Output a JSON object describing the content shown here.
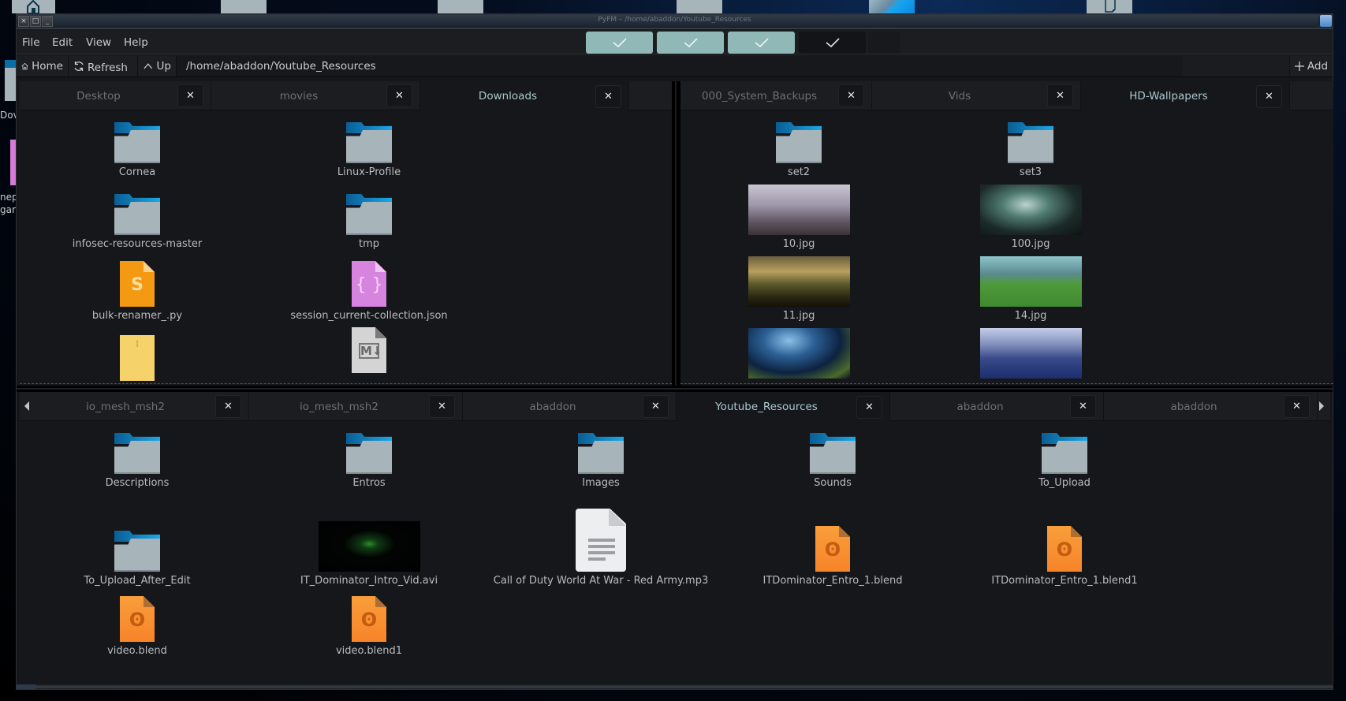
{
  "window": {
    "title": "PyFM – /home/abaddon/Youtube_Resources",
    "controls": [
      "close",
      "maximize",
      "minimize"
    ]
  },
  "desktop": {
    "left_labels": [
      "Dov",
      "nep",
      "gar"
    ]
  },
  "menubar": {
    "items": [
      "File",
      "Edit",
      "View",
      "Help"
    ],
    "check_buttons": [
      {
        "checked": true,
        "style": "active"
      },
      {
        "checked": true,
        "style": "active"
      },
      {
        "checked": true,
        "style": "active"
      },
      {
        "checked": true,
        "style": "inactive"
      }
    ]
  },
  "toolbar": {
    "home_label": "Home",
    "refresh_label": "Refresh",
    "up_label": "Up",
    "path": "/home/abaddon/Youtube_Resources",
    "add_label": "Add"
  },
  "panes": {
    "top_left": {
      "tabs": [
        {
          "label": "Desktop",
          "active": false
        },
        {
          "label": "movies",
          "active": false
        },
        {
          "label": "Downloads",
          "active": true
        }
      ],
      "items": [
        {
          "name": "Cornea",
          "type": "folder"
        },
        {
          "name": "Linux-Profile",
          "type": "folder"
        },
        {
          "name": "infosec-resources-master",
          "type": "folder"
        },
        {
          "name": "tmp",
          "type": "folder"
        },
        {
          "name": "bulk-renamer_.py",
          "type": "python"
        },
        {
          "name": "session_current-collection.json",
          "type": "json"
        },
        {
          "name": "",
          "type": "archive"
        },
        {
          "name": "",
          "type": "markdown"
        }
      ]
    },
    "top_right": {
      "tabs": [
        {
          "label": "000_System_Backups",
          "active": false
        },
        {
          "label": "Vids",
          "active": false
        },
        {
          "label": "HD-Wallpapers",
          "active": true
        }
      ],
      "items": [
        {
          "name": "set2",
          "type": "folder"
        },
        {
          "name": "set3",
          "type": "folder"
        },
        {
          "name": "10.jpg",
          "type": "image"
        },
        {
          "name": "100.jpg",
          "type": "image"
        },
        {
          "name": "11.jpg",
          "type": "image"
        },
        {
          "name": "14.jpg",
          "type": "image"
        },
        {
          "name": "",
          "type": "image"
        },
        {
          "name": "",
          "type": "image"
        }
      ]
    },
    "bottom": {
      "tabs": [
        {
          "label": "io_mesh_msh2",
          "active": false
        },
        {
          "label": "io_mesh_msh2",
          "active": false
        },
        {
          "label": "abaddon",
          "active": false
        },
        {
          "label": "Youtube_Resources",
          "active": true
        },
        {
          "label": "abaddon",
          "active": false
        },
        {
          "label": "abaddon",
          "active": false
        }
      ],
      "items": [
        {
          "name": "Descriptions",
          "type": "folder"
        },
        {
          "name": "Entros",
          "type": "folder"
        },
        {
          "name": "Images",
          "type": "folder"
        },
        {
          "name": "Sounds",
          "type": "folder"
        },
        {
          "name": "To_Upload",
          "type": "folder"
        },
        {
          "name": "To_Upload_After_Edit",
          "type": "folder"
        },
        {
          "name": "IT_Dominator_Intro_Vid.avi",
          "type": "video"
        },
        {
          "name": "Call of Duty World At War - Red Army.mp3",
          "type": "audio"
        },
        {
          "name": "ITDominator_Entro_1.blend",
          "type": "blend"
        },
        {
          "name": "ITDominator_Entro_1.blend1",
          "type": "blend"
        },
        {
          "name": "video.blend",
          "type": "blend"
        },
        {
          "name": "video.blend1",
          "type": "blend"
        }
      ]
    }
  },
  "icons": {
    "close_tab": "✕",
    "check": "check-icon",
    "home": "home-icon",
    "refresh": "refresh-icon",
    "up": "chevron-up-icon",
    "add": "plus-icon",
    "scroll_left": "triangle-left-icon",
    "scroll_right": "triangle-right-icon"
  },
  "colors": {
    "accent_check": "#8fb8b6",
    "active_tab_text": "#a9c9cf",
    "folder_tab": "#1aa8e8",
    "folder_body": "#a7b4ba"
  }
}
